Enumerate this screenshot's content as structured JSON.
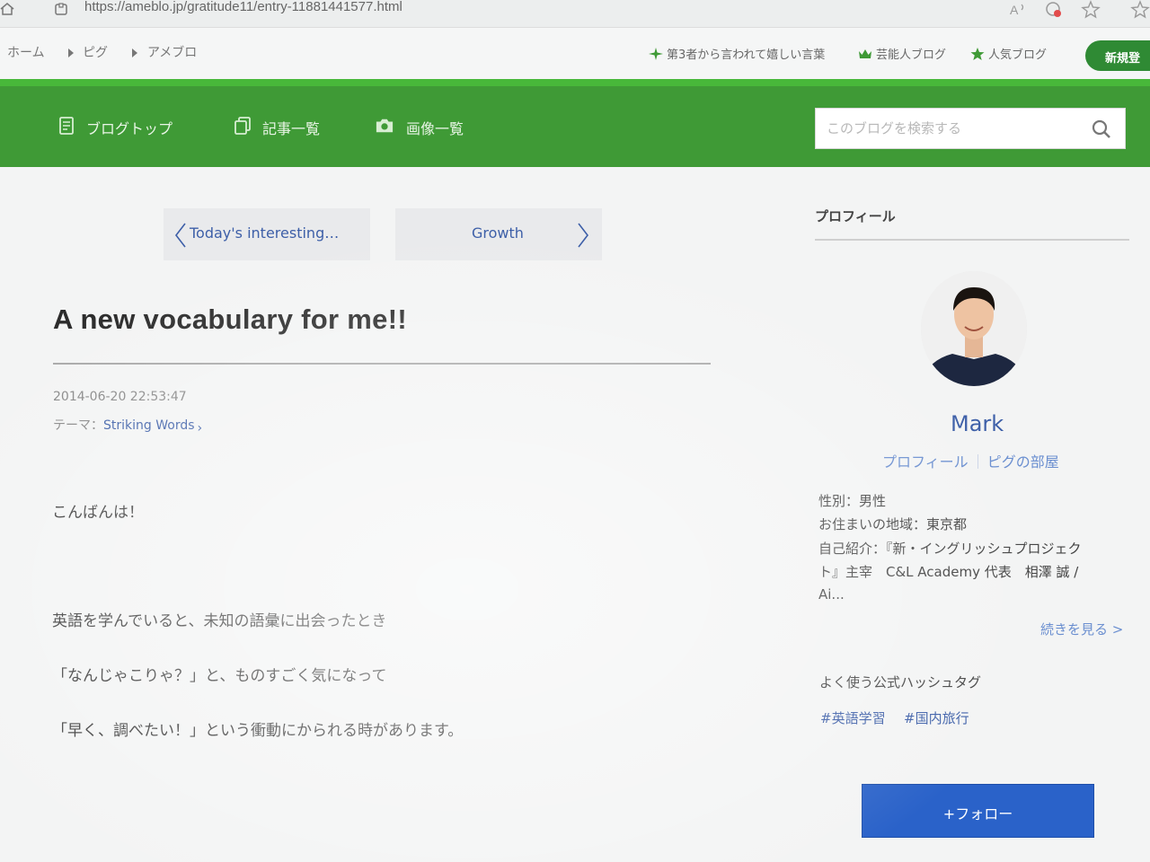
{
  "browser": {
    "url": "https://ameblo.jp/gratitude11/entry-11881441577.html",
    "toolbar_icons": [
      "read-aloud-icon",
      "extension-icon",
      "favorite-icon",
      "collections-icon"
    ]
  },
  "topnav": {
    "breadcrumbs": [
      "ホーム",
      "ピグ",
      "アメブロ"
    ],
    "links": [
      {
        "label": "第3者から言われて嬉しい言葉",
        "icon": "sparkle-icon"
      },
      {
        "label": "芸能人ブログ",
        "icon": "crown-icon"
      },
      {
        "label": "人気ブログ",
        "icon": "star-icon"
      }
    ],
    "new_post_label": "新規登"
  },
  "header": {
    "nav": [
      {
        "label": "ブログトップ",
        "icon": "document-icon"
      },
      {
        "label": "記事一覧",
        "icon": "pages-icon"
      },
      {
        "label": "画像一覧",
        "icon": "camera-icon"
      }
    ],
    "search_placeholder": "このブログを検索する"
  },
  "pager": {
    "prev_label": "Today's interesting…",
    "next_label": "Growth"
  },
  "article": {
    "title": "A new vocabulary for me!!",
    "date": "2014-06-20 22:53:47",
    "theme_prefix": "テーマ：",
    "theme": "Striking Words",
    "paragraphs": [
      "こんばんは！",
      "英語を学んでいると、未知の語彙に出会ったとき",
      "「なんじゃこりゃ？」と、ものすごく気になって",
      "「早く、調べたい！」という衝動にかられる時があります。"
    ]
  },
  "sidebar": {
    "heading": "プロフィール",
    "name": "Mark",
    "profile_link": "プロフィール",
    "pigg_link": "ピグの部屋",
    "info": [
      "性別：男性",
      "お住まいの地域：東京都",
      "自己紹介：『新・イングリッシュプロジェク",
      "ト』主宰　C&L Academy 代表　相澤 誠 /",
      "Ai..."
    ],
    "more_label": "続きを見る >",
    "hashtag_heading": "よく使う公式ハッシュタグ",
    "hashtags": [
      "#英語学習",
      "#国内旅行"
    ],
    "follow_label": "+フォロー"
  },
  "colors": {
    "brand_green": "#3f9a36",
    "link_blue": "#3d5fa8",
    "follow_blue": "#2a62c9"
  }
}
